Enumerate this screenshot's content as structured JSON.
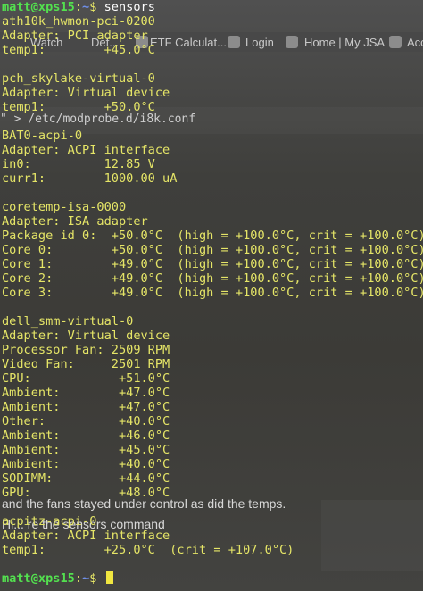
{
  "background": {
    "bookmarks": [
      "Watch",
      "Def...",
      "ETF Calculat...",
      "Login",
      "Home | My JSA",
      "Acc"
    ],
    "command_text": "\" > /etc/modprobe.d/i8k.conf",
    "article_line1": "and the fans stayed under control as did the temps.",
    "article_line2": "Hi... re the sensors command"
  },
  "prompt": {
    "user": "matt@xps15",
    "path": "~",
    "sign": "$"
  },
  "command": "sensors",
  "output": {
    "ath10k": {
      "name": "ath10k_hwmon-pci-0200",
      "adapter": "Adapter: PCI adapter",
      "temp1": "temp1:        +45.0°C"
    },
    "pch": {
      "name": "pch_skylake-virtual-0",
      "adapter": "Adapter: Virtual device",
      "temp1": "temp1:        +50.0°C"
    },
    "bat0": {
      "name": "BAT0-acpi-0",
      "adapter": "Adapter: ACPI interface",
      "in0": "in0:          12.85 V",
      "curr1": "curr1:        1000.00 uA"
    },
    "coretemp": {
      "name": "coretemp-isa-0000",
      "adapter": "Adapter: ISA adapter",
      "lines": [
        "Package id 0:  +50.0°C  (high = +100.0°C, crit = +100.0°C)",
        "Core 0:        +50.0°C  (high = +100.0°C, crit = +100.0°C)",
        "Core 1:        +49.0°C  (high = +100.0°C, crit = +100.0°C)",
        "Core 2:        +49.0°C  (high = +100.0°C, crit = +100.0°C)",
        "Core 3:        +49.0°C  (high = +100.0°C, crit = +100.0°C)"
      ]
    },
    "dell_smm": {
      "name": "dell_smm-virtual-0",
      "adapter": "Adapter: Virtual device",
      "lines": [
        "Processor Fan: 2509 RPM",
        "Video Fan:     2501 RPM",
        "CPU:            +51.0°C",
        "Ambient:        +47.0°C",
        "Ambient:        +47.0°C",
        "Other:          +40.0°C",
        "Ambient:        +46.0°C",
        "Ambient:        +45.0°C",
        "Ambient:        +40.0°C",
        "SODIMM:         +44.0°C",
        "GPU:            +48.0°C"
      ]
    },
    "acpitz": {
      "name": "acpitz-acpi-0",
      "adapter": "Adapter: ACPI interface",
      "temp1": "temp1:        +25.0°C  (crit = +107.0°C)"
    }
  }
}
